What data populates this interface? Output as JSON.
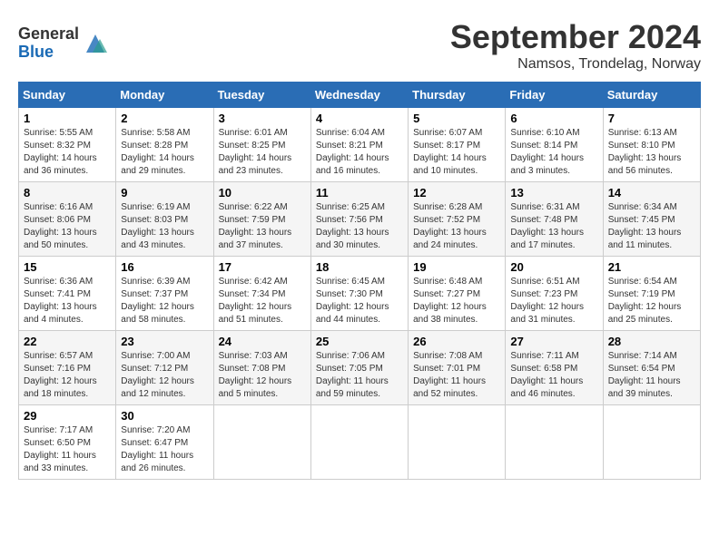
{
  "header": {
    "logo_general": "General",
    "logo_blue": "Blue",
    "month_title": "September 2024",
    "location": "Namsos, Trondelag, Norway"
  },
  "days_of_week": [
    "Sunday",
    "Monday",
    "Tuesday",
    "Wednesday",
    "Thursday",
    "Friday",
    "Saturday"
  ],
  "weeks": [
    [
      {
        "day": "1",
        "content": "Sunrise: 5:55 AM\nSunset: 8:32 PM\nDaylight: 14 hours\nand 36 minutes."
      },
      {
        "day": "2",
        "content": "Sunrise: 5:58 AM\nSunset: 8:28 PM\nDaylight: 14 hours\nand 29 minutes."
      },
      {
        "day": "3",
        "content": "Sunrise: 6:01 AM\nSunset: 8:25 PM\nDaylight: 14 hours\nand 23 minutes."
      },
      {
        "day": "4",
        "content": "Sunrise: 6:04 AM\nSunset: 8:21 PM\nDaylight: 14 hours\nand 16 minutes."
      },
      {
        "day": "5",
        "content": "Sunrise: 6:07 AM\nSunset: 8:17 PM\nDaylight: 14 hours\nand 10 minutes."
      },
      {
        "day": "6",
        "content": "Sunrise: 6:10 AM\nSunset: 8:14 PM\nDaylight: 14 hours\nand 3 minutes."
      },
      {
        "day": "7",
        "content": "Sunrise: 6:13 AM\nSunset: 8:10 PM\nDaylight: 13 hours\nand 56 minutes."
      }
    ],
    [
      {
        "day": "8",
        "content": "Sunrise: 6:16 AM\nSunset: 8:06 PM\nDaylight: 13 hours\nand 50 minutes."
      },
      {
        "day": "9",
        "content": "Sunrise: 6:19 AM\nSunset: 8:03 PM\nDaylight: 13 hours\nand 43 minutes."
      },
      {
        "day": "10",
        "content": "Sunrise: 6:22 AM\nSunset: 7:59 PM\nDaylight: 13 hours\nand 37 minutes."
      },
      {
        "day": "11",
        "content": "Sunrise: 6:25 AM\nSunset: 7:56 PM\nDaylight: 13 hours\nand 30 minutes."
      },
      {
        "day": "12",
        "content": "Sunrise: 6:28 AM\nSunset: 7:52 PM\nDaylight: 13 hours\nand 24 minutes."
      },
      {
        "day": "13",
        "content": "Sunrise: 6:31 AM\nSunset: 7:48 PM\nDaylight: 13 hours\nand 17 minutes."
      },
      {
        "day": "14",
        "content": "Sunrise: 6:34 AM\nSunset: 7:45 PM\nDaylight: 13 hours\nand 11 minutes."
      }
    ],
    [
      {
        "day": "15",
        "content": "Sunrise: 6:36 AM\nSunset: 7:41 PM\nDaylight: 13 hours\nand 4 minutes."
      },
      {
        "day": "16",
        "content": "Sunrise: 6:39 AM\nSunset: 7:37 PM\nDaylight: 12 hours\nand 58 minutes."
      },
      {
        "day": "17",
        "content": "Sunrise: 6:42 AM\nSunset: 7:34 PM\nDaylight: 12 hours\nand 51 minutes."
      },
      {
        "day": "18",
        "content": "Sunrise: 6:45 AM\nSunset: 7:30 PM\nDaylight: 12 hours\nand 44 minutes."
      },
      {
        "day": "19",
        "content": "Sunrise: 6:48 AM\nSunset: 7:27 PM\nDaylight: 12 hours\nand 38 minutes."
      },
      {
        "day": "20",
        "content": "Sunrise: 6:51 AM\nSunset: 7:23 PM\nDaylight: 12 hours\nand 31 minutes."
      },
      {
        "day": "21",
        "content": "Sunrise: 6:54 AM\nSunset: 7:19 PM\nDaylight: 12 hours\nand 25 minutes."
      }
    ],
    [
      {
        "day": "22",
        "content": "Sunrise: 6:57 AM\nSunset: 7:16 PM\nDaylight: 12 hours\nand 18 minutes."
      },
      {
        "day": "23",
        "content": "Sunrise: 7:00 AM\nSunset: 7:12 PM\nDaylight: 12 hours\nand 12 minutes."
      },
      {
        "day": "24",
        "content": "Sunrise: 7:03 AM\nSunset: 7:08 PM\nDaylight: 12 hours\nand 5 minutes."
      },
      {
        "day": "25",
        "content": "Sunrise: 7:06 AM\nSunset: 7:05 PM\nDaylight: 11 hours\nand 59 minutes."
      },
      {
        "day": "26",
        "content": "Sunrise: 7:08 AM\nSunset: 7:01 PM\nDaylight: 11 hours\nand 52 minutes."
      },
      {
        "day": "27",
        "content": "Sunrise: 7:11 AM\nSunset: 6:58 PM\nDaylight: 11 hours\nand 46 minutes."
      },
      {
        "day": "28",
        "content": "Sunrise: 7:14 AM\nSunset: 6:54 PM\nDaylight: 11 hours\nand 39 minutes."
      }
    ],
    [
      {
        "day": "29",
        "content": "Sunrise: 7:17 AM\nSunset: 6:50 PM\nDaylight: 11 hours\nand 33 minutes."
      },
      {
        "day": "30",
        "content": "Sunrise: 7:20 AM\nSunset: 6:47 PM\nDaylight: 11 hours\nand 26 minutes."
      },
      {
        "day": "",
        "content": ""
      },
      {
        "day": "",
        "content": ""
      },
      {
        "day": "",
        "content": ""
      },
      {
        "day": "",
        "content": ""
      },
      {
        "day": "",
        "content": ""
      }
    ]
  ]
}
